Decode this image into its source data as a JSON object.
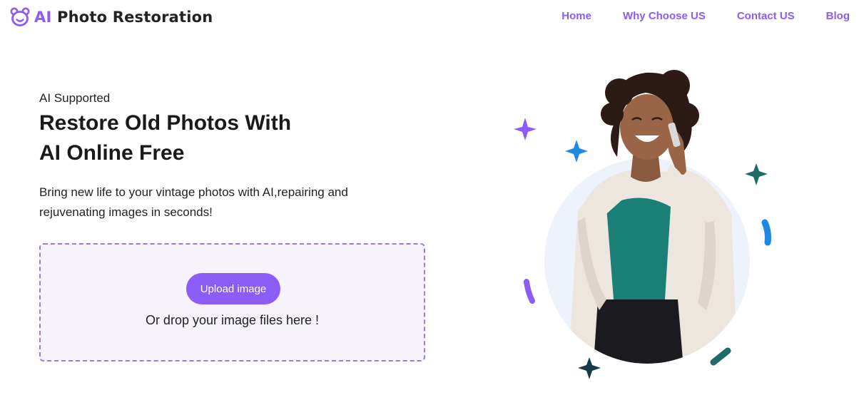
{
  "header": {
    "logo": {
      "icon": "bear-face-icon",
      "accent": "AI",
      "text": " Photo Restoration"
    },
    "nav": [
      {
        "label": "Home"
      },
      {
        "label": "Why Choose US"
      },
      {
        "label": "Contact US"
      },
      {
        "label": "Blog"
      }
    ]
  },
  "hero": {
    "eyebrow": "AI Supported",
    "title_line1": "Restore Old Photos With",
    "title_line2": "AI Online Free",
    "description": "Bring new life to your vintage photos with AI,repairing and rejuvenating images in seconds!",
    "upload": {
      "button_label": "Upload image",
      "drop_text": "Or drop your image files here !"
    }
  },
  "illustration": {
    "subject": "woman-on-phone-photo",
    "decorations": [
      "sparkle-icon",
      "sparkle-icon",
      "sparkle-icon",
      "sparkle-icon"
    ]
  },
  "colors": {
    "brand": "#8b5cf6",
    "dropzone_bg": "#f6f3fd",
    "dropzone_border": "#9f75ea",
    "sparkle_purple": "#8b5cf6",
    "sparkle_blue": "#1e88e5",
    "sparkle_teal": "#1f6b66",
    "sparkle_dark": "#163a4a"
  }
}
